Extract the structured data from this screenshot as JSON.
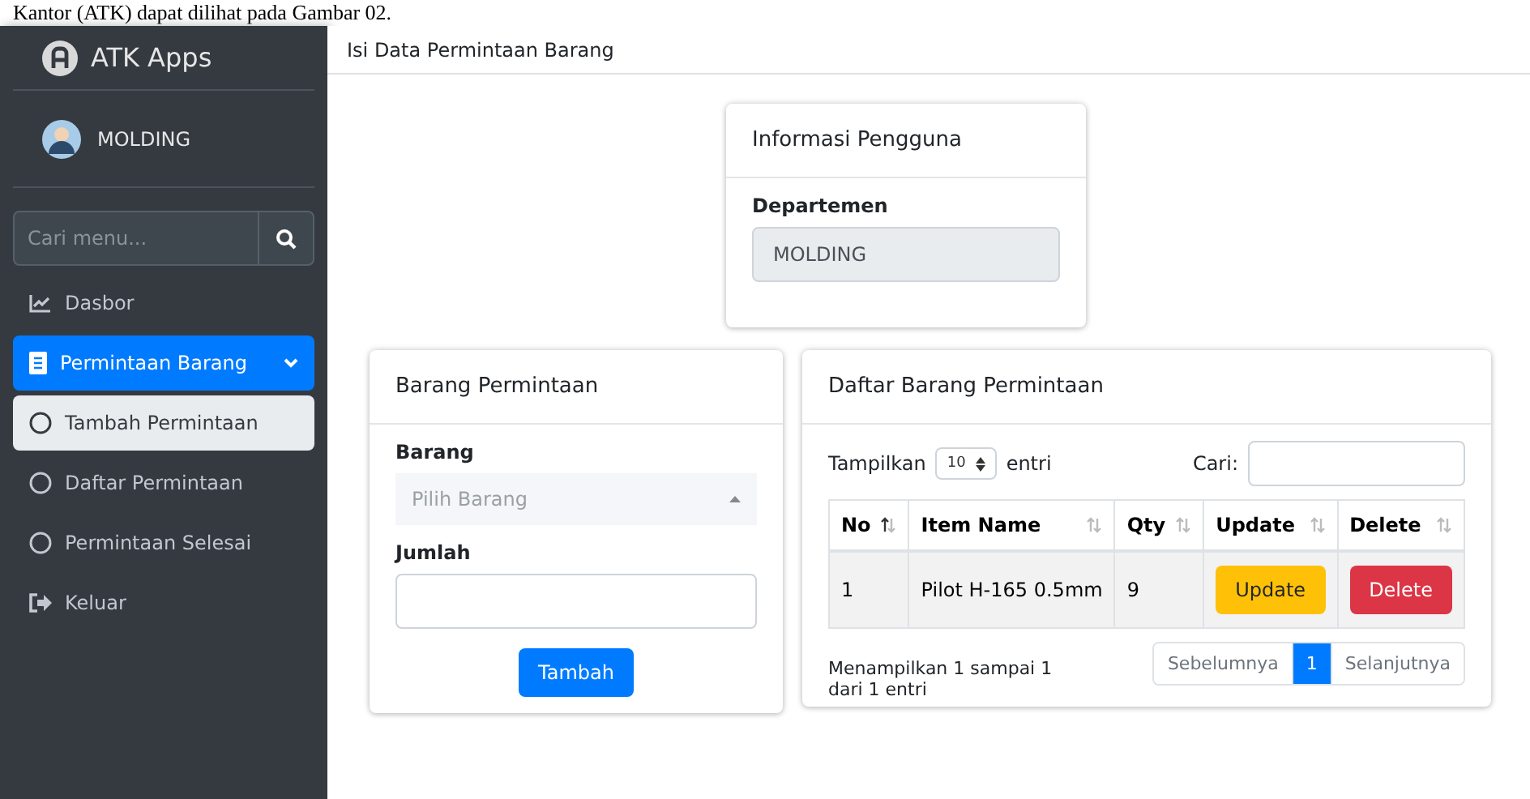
{
  "caption": "Kantor (ATK) dapat dilihat pada Gambar 02.",
  "brand": {
    "title": "ATK Apps"
  },
  "user": {
    "name": "MOLDING"
  },
  "sidebar": {
    "search": {
      "placeholder": "Cari menu..."
    },
    "items": [
      {
        "label": "Dasbor",
        "kind": "chart",
        "selected": false
      },
      {
        "label": "Permintaan Barang",
        "kind": "doc",
        "selected": true,
        "expanded": true,
        "children": [
          {
            "label": "Tambah Permintaan",
            "selected": true
          },
          {
            "label": "Daftar Permintaan",
            "selected": false
          },
          {
            "label": "Permintaan Selesai",
            "selected": false
          }
        ]
      },
      {
        "label": "Keluar",
        "kind": "exit",
        "selected": false
      }
    ]
  },
  "header": {
    "title": "Isi Data Permintaan Barang"
  },
  "user_card": {
    "title": "Informasi Pengguna",
    "label": "Departemen",
    "value": "MOLDING"
  },
  "form_card": {
    "title": "Barang Permintaan",
    "barang_label": "Barang",
    "barang_placeholder": "Pilih Barang",
    "jumlah_label": "Jumlah",
    "button": "Tambah"
  },
  "list_card": {
    "title": "Daftar Barang Permintaan",
    "show_label": "Tampilkan",
    "page_size": "10",
    "entries_label": "entri",
    "search_label": "Cari:",
    "columns": [
      {
        "label": "No",
        "sorted": true
      },
      {
        "label": "Item Name",
        "sorted": false
      },
      {
        "label": "Qty",
        "sorted": false
      },
      {
        "label": "Update",
        "sorted": false
      },
      {
        "label": "Delete",
        "sorted": false
      }
    ],
    "rows": [
      {
        "no": "1",
        "item": "Pilot H-165 0.5mm",
        "qty": "9",
        "update": "Update",
        "delete": "Delete"
      }
    ],
    "info": "Menampilkan 1 sampai 1 dari 1 entri",
    "pagination": [
      {
        "label": "Sebelumnya",
        "selected": false
      },
      {
        "label": "1",
        "selected": true
      },
      {
        "label": "Selanjutnya",
        "selected": false
      }
    ]
  }
}
